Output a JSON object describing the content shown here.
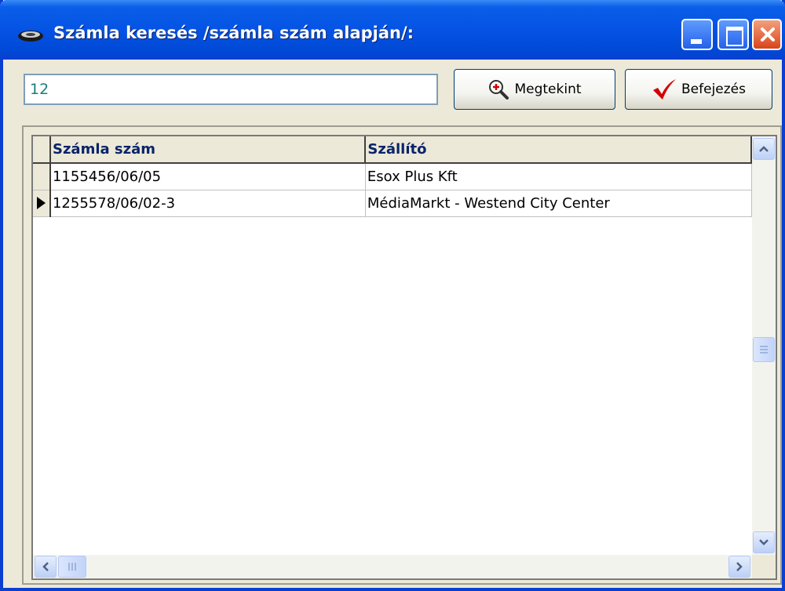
{
  "window": {
    "title": "Számla keresés /számla szám alapján/:"
  },
  "search": {
    "value": "12"
  },
  "toolbar": {
    "view_label": "Megtekint",
    "finish_label": "Befejezés"
  },
  "table": {
    "columns": [
      "Számla szám",
      "Szállító"
    ],
    "rows": [
      {
        "invoice_number": "1155456/06/05",
        "supplier": "Esox Plus Kft",
        "current": false
      },
      {
        "invoice_number": "1255578/06/02-3",
        "supplier": "MédiaMarkt - Westend City Center",
        "current": true
      }
    ]
  },
  "colors": {
    "title_bar": "#0553e4",
    "header_text": "#0a246a",
    "checkmark": "#d40000",
    "close_button": "#d9441a"
  },
  "icons": [
    "app-icon",
    "minimize-icon",
    "maximize-icon",
    "close-icon",
    "magnifier-icon",
    "checkmark-icon",
    "row-pointer-icon",
    "scroll-up-icon",
    "scroll-down-icon",
    "scroll-left-icon",
    "scroll-right-icon"
  ]
}
